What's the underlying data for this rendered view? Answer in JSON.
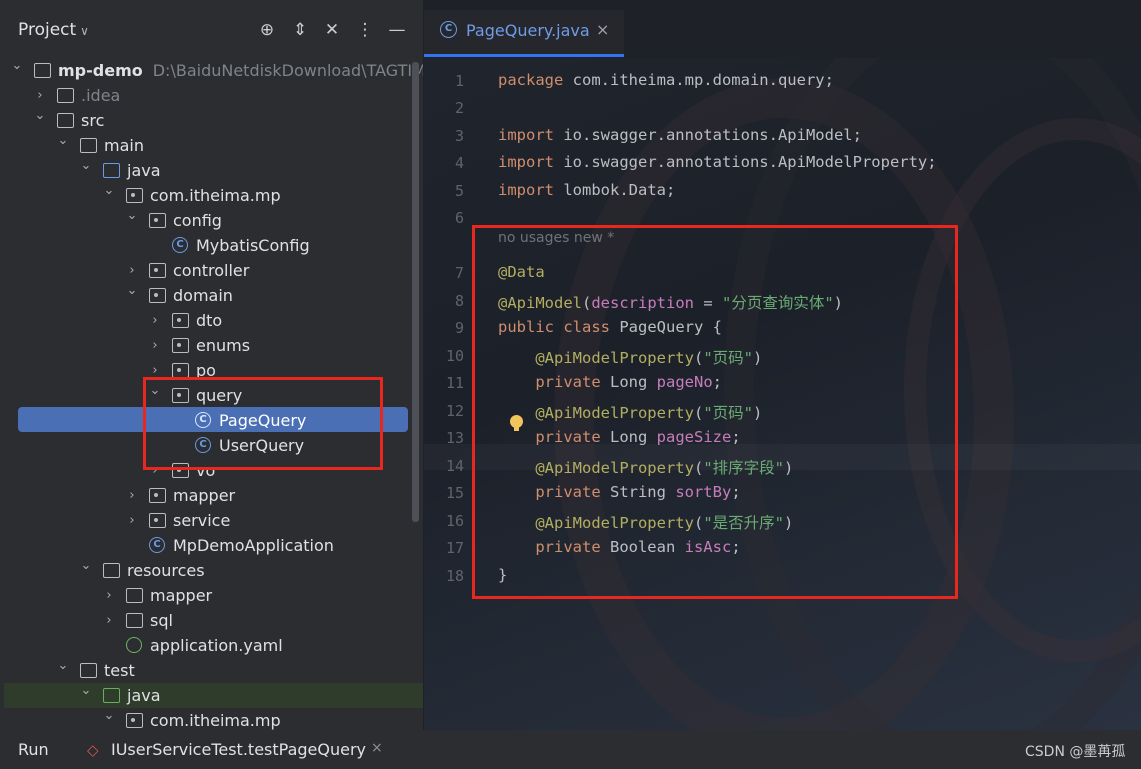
{
  "project": {
    "title": "Project",
    "header_icons": [
      "crosshair-icon",
      "expand-icon",
      "collapse-icon",
      "more-icon",
      "minimize-icon"
    ],
    "tree": [
      {
        "label": "mp-demo",
        "path": "D:\\BaiduNetdiskDownload\\TAGTIME",
        "icon": "module",
        "indent": 0,
        "arrow": "down"
      },
      {
        "label": ".idea",
        "icon": "folder",
        "indent": 1,
        "arrow": "right"
      },
      {
        "label": "src",
        "icon": "folder",
        "indent": 1,
        "arrow": "down"
      },
      {
        "label": "main",
        "icon": "folder",
        "indent": 2,
        "arrow": "down"
      },
      {
        "label": "java",
        "icon": "folder-blue",
        "indent": 3,
        "arrow": "down"
      },
      {
        "label": "com.itheima.mp",
        "icon": "package",
        "indent": 4,
        "arrow": "down"
      },
      {
        "label": "config",
        "icon": "package",
        "indent": 5,
        "arrow": "down"
      },
      {
        "label": "MybatisConfig",
        "icon": "class",
        "indent": 6,
        "arrow": ""
      },
      {
        "label": "controller",
        "icon": "package",
        "indent": 5,
        "arrow": "right"
      },
      {
        "label": "domain",
        "icon": "package",
        "indent": 5,
        "arrow": "down"
      },
      {
        "label": "dto",
        "icon": "package",
        "indent": 6,
        "arrow": "right"
      },
      {
        "label": "enums",
        "icon": "package",
        "indent": 6,
        "arrow": "right"
      },
      {
        "label": "po",
        "icon": "package",
        "indent": 6,
        "arrow": "right"
      },
      {
        "label": "query",
        "icon": "package",
        "indent": 6,
        "arrow": "down"
      },
      {
        "label": "PageQuery",
        "icon": "class",
        "indent": 7,
        "arrow": "",
        "selected": true
      },
      {
        "label": "UserQuery",
        "icon": "class",
        "indent": 7,
        "arrow": ""
      },
      {
        "label": "vo",
        "icon": "package",
        "indent": 6,
        "arrow": "right"
      },
      {
        "label": "mapper",
        "icon": "package",
        "indent": 5,
        "arrow": "right"
      },
      {
        "label": "service",
        "icon": "package",
        "indent": 5,
        "arrow": "right"
      },
      {
        "label": "MpDemoApplication",
        "icon": "class",
        "indent": 5,
        "arrow": ""
      },
      {
        "label": "resources",
        "icon": "folder-res",
        "indent": 3,
        "arrow": "down"
      },
      {
        "label": "mapper",
        "icon": "folder",
        "indent": 4,
        "arrow": "right"
      },
      {
        "label": "sql",
        "icon": "folder",
        "indent": 4,
        "arrow": "right"
      },
      {
        "label": "application.yaml",
        "icon": "yaml",
        "indent": 4,
        "arrow": ""
      },
      {
        "label": "test",
        "icon": "folder",
        "indent": 2,
        "arrow": "down"
      },
      {
        "label": "java",
        "icon": "folder-green",
        "indent": 3,
        "arrow": "down"
      },
      {
        "label": "com.itheima.mp",
        "icon": "package",
        "indent": 4,
        "arrow": "down"
      }
    ]
  },
  "editor": {
    "tab_label": "PageQuery.java",
    "tab_close": "×",
    "usage_hint": "no usages   new *",
    "lines": [
      {
        "n": "1",
        "parts": [
          [
            "kw",
            "package "
          ],
          [
            "",
            "com.itheima.mp.domain.query;"
          ]
        ]
      },
      {
        "n": "2",
        "parts": []
      },
      {
        "n": "3",
        "parts": [
          [
            "kw",
            "import "
          ],
          [
            "",
            "io.swagger.annotations.ApiModel;"
          ]
        ]
      },
      {
        "n": "4",
        "parts": [
          [
            "kw",
            "import "
          ],
          [
            "",
            "io.swagger.annotations.ApiModelProperty;"
          ]
        ]
      },
      {
        "n": "5",
        "parts": [
          [
            "kw",
            "import "
          ],
          [
            "",
            "lombok.Data;"
          ]
        ]
      },
      {
        "n": "6",
        "parts": []
      },
      {
        "n": "7",
        "parts": [
          [
            "an",
            "@Data"
          ]
        ]
      },
      {
        "n": "8",
        "parts": [
          [
            "an",
            "@ApiModel"
          ],
          [
            "",
            "("
          ],
          [
            "fld",
            "description"
          ],
          [
            "",
            " = "
          ],
          [
            "str",
            "\"分页查询实体\""
          ],
          [
            "",
            ")"
          ]
        ]
      },
      {
        "n": "9",
        "parts": [
          [
            "kw",
            "public class "
          ],
          [
            "",
            "PageQuery {"
          ]
        ]
      },
      {
        "n": "10",
        "parts": [
          [
            "",
            "    "
          ],
          [
            "an",
            "@ApiModelProperty"
          ],
          [
            "",
            "("
          ],
          [
            "str",
            "\"页码\""
          ],
          [
            "",
            ")"
          ]
        ]
      },
      {
        "n": "11",
        "parts": [
          [
            "",
            "    "
          ],
          [
            "kw",
            "private "
          ],
          [
            "",
            "Long "
          ],
          [
            "fld",
            "pageNo"
          ],
          [
            "",
            ";"
          ]
        ]
      },
      {
        "n": "12",
        "parts": [
          [
            "",
            "    "
          ],
          [
            "an",
            "@ApiModelProperty"
          ],
          [
            "",
            "("
          ],
          [
            "str",
            "\"页码\""
          ],
          [
            "",
            ")"
          ]
        ]
      },
      {
        "n": "13",
        "parts": [
          [
            "",
            "    "
          ],
          [
            "kw",
            "private "
          ],
          [
            "",
            "Long "
          ],
          [
            "fld",
            "pageSize"
          ],
          [
            "",
            ";"
          ]
        ]
      },
      {
        "n": "14",
        "parts": [
          [
            "",
            "    "
          ],
          [
            "an",
            "@ApiModelProperty"
          ],
          [
            "",
            "("
          ],
          [
            "str",
            "\"排序字段\""
          ],
          [
            "",
            ")"
          ]
        ]
      },
      {
        "n": "15",
        "parts": [
          [
            "",
            "    "
          ],
          [
            "kw",
            "private "
          ],
          [
            "",
            "String "
          ],
          [
            "fld",
            "sortBy"
          ],
          [
            "",
            ";"
          ]
        ]
      },
      {
        "n": "16",
        "parts": [
          [
            "",
            "    "
          ],
          [
            "an",
            "@ApiModelProperty"
          ],
          [
            "",
            "("
          ],
          [
            "str",
            "\"是否升序\""
          ],
          [
            "",
            ")"
          ]
        ]
      },
      {
        "n": "17",
        "parts": [
          [
            "",
            "    "
          ],
          [
            "kw",
            "private "
          ],
          [
            "",
            "Boolean "
          ],
          [
            "fld",
            "isAsc"
          ],
          [
            "",
            ";"
          ]
        ]
      },
      {
        "n": "18",
        "parts": [
          [
            "",
            "}"
          ]
        ]
      }
    ]
  },
  "run": {
    "label": "Run",
    "tab_label": "IUserServiceTest.testPageQuery",
    "close": "×"
  },
  "watermark": "CSDN @墨苒孤",
  "colors": {
    "accent": "#3574f0",
    "selection": "#4a6fb5",
    "highlight_box": "#e8281f"
  }
}
